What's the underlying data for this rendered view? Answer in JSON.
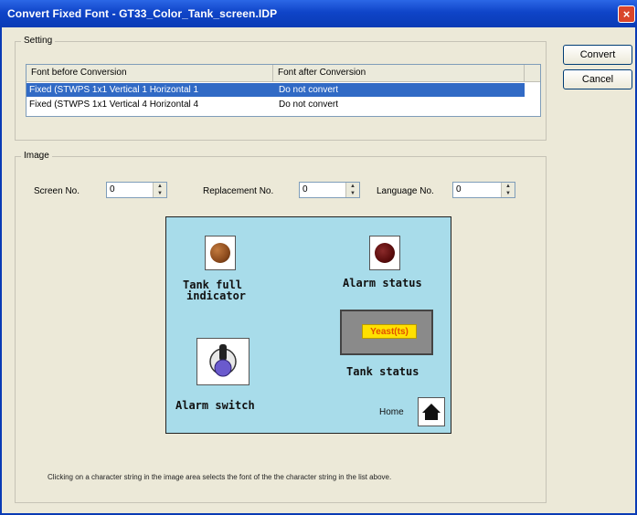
{
  "window": {
    "title": "Convert Fixed Font - GT33_Color_Tank_screen.IDP",
    "close_glyph": "×"
  },
  "buttons": {
    "convert": "Convert",
    "cancel": "Cancel"
  },
  "setting": {
    "group_label": "Setting",
    "columns": [
      "Font before Conversion",
      "Font after Conversion"
    ],
    "rows": [
      {
        "before": "Fixed (STWPS 1x1 Vertical 1 Horizontal 1",
        "after": "Do not convert",
        "selected": true
      },
      {
        "before": "Fixed (STWPS 1x1 Vertical 4 Horizontal 4",
        "after": "Do not convert",
        "selected": false
      }
    ]
  },
  "image": {
    "group_label": "Image",
    "screen_no_label": "Screen No.",
    "screen_no_value": "0",
    "replacement_no_label": "Replacement No.",
    "replacement_no_value": "0",
    "language_no_label": "Language No.",
    "language_no_value": "0"
  },
  "preview": {
    "tank_full_line1": "Tank full",
    "tank_full_line2": "indicator",
    "alarm_status": "Alarm status",
    "status_box_text": "Yeast(ts)",
    "tank_status": "Tank status",
    "alarm_switch": "Alarm switch",
    "home": "Home",
    "colors": {
      "background": "#a8dcea",
      "tank_lamp": "#8b4a1c",
      "alarm_lamp": "#6a0f0f",
      "status_fill": "#ffe000"
    }
  },
  "footnote": "Clicking on a character string in the image area selects the font of the the character string in the list above."
}
